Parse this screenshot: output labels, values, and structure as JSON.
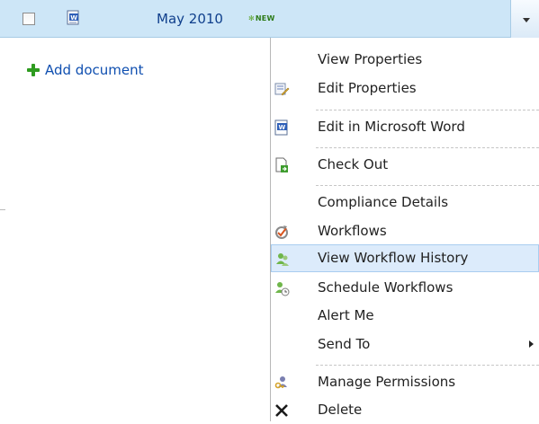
{
  "document": {
    "title": "May 2010",
    "badge": "NEW",
    "badge_icon": "new-sparkle-icon",
    "file_icon": "word-document-icon"
  },
  "add_document": {
    "label": "Add document",
    "icon": "plus-icon"
  },
  "menu": {
    "items": [
      {
        "label": "View Properties",
        "icon": ""
      },
      {
        "label": "Edit Properties",
        "icon": "edit-properties-icon"
      },
      {
        "label": "Edit in Microsoft Word",
        "icon": "word-document-icon"
      },
      {
        "label": "Check Out",
        "icon": "check-out-icon"
      },
      {
        "label": "Compliance Details",
        "icon": ""
      },
      {
        "label": "Workflows",
        "icon": "workflow-icon"
      },
      {
        "label": "View Workflow History",
        "icon": "users-icon"
      },
      {
        "label": "Schedule Workflows",
        "icon": "users-clock-icon"
      },
      {
        "label": "Alert Me",
        "icon": ""
      },
      {
        "label": "Send To",
        "icon": ""
      },
      {
        "label": "Manage Permissions",
        "icon": "permissions-icon"
      },
      {
        "label": "Delete",
        "icon": "delete-icon"
      }
    ]
  },
  "colors": {
    "row_background": "#cde6f7",
    "link": "#0f4fb0",
    "highlight": "#dcebfb"
  }
}
